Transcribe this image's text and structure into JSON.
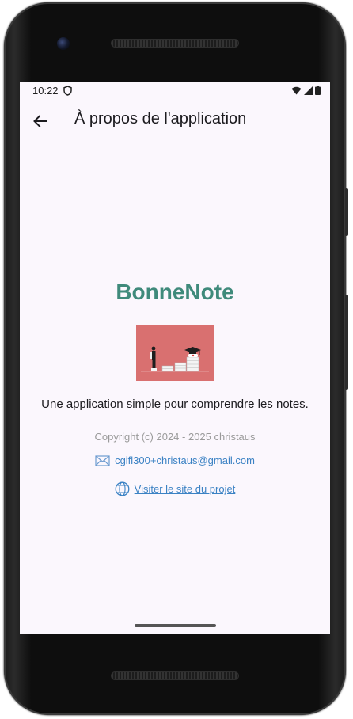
{
  "status_bar": {
    "time": "10:22"
  },
  "app_bar": {
    "title": "À propos de l'application"
  },
  "about": {
    "app_name": "BonneNote",
    "description": "Une application simple pour comprendre les notes.",
    "copyright": "Copyright (c) 2024 - 2025 christaus",
    "email": "cgifl300+christaus@gmail.com",
    "site_link": "Visiter le site du projet"
  },
  "colors": {
    "accent": "#3f8a7b",
    "link": "#3b82c4",
    "background": "#fbf7fd",
    "illustration_bg": "#d97070"
  },
  "icons": {
    "back": "arrow-left-icon",
    "email": "envelope-icon",
    "site": "globe-icon"
  }
}
